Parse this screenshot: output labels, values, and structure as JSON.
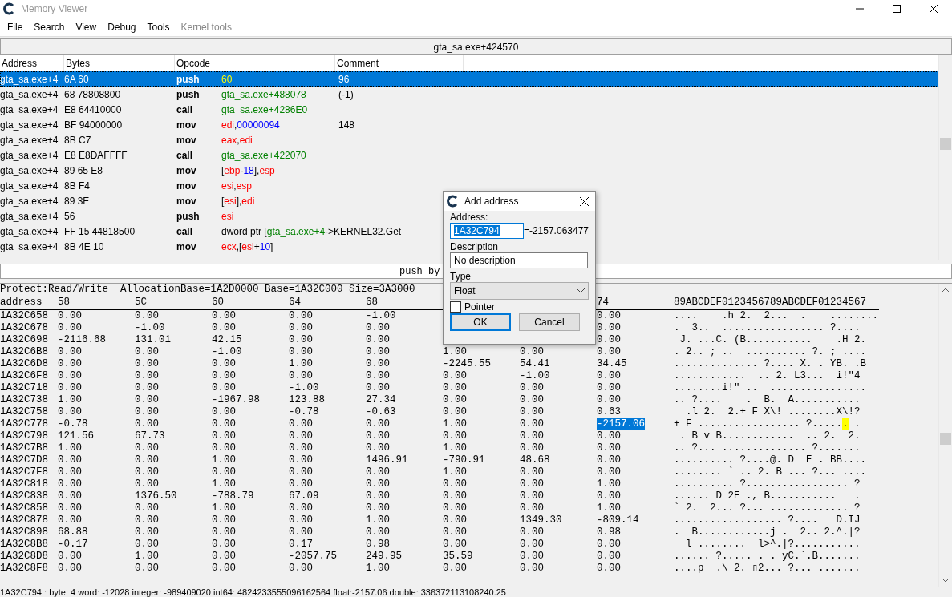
{
  "window": {
    "title": "Memory Viewer"
  },
  "menu": [
    {
      "label": "File",
      "disabled": false
    },
    {
      "label": "Search",
      "disabled": false
    },
    {
      "label": "View",
      "disabled": false
    },
    {
      "label": "Debug",
      "disabled": false
    },
    {
      "label": "Tools",
      "disabled": false
    },
    {
      "label": "Kernel tools",
      "disabled": true
    }
  ],
  "address_bar": "gta_sa.exe+424570",
  "disassembler": {
    "columns": [
      "Address",
      "Bytes",
      "Opcode",
      "Comment"
    ],
    "rows": [
      {
        "address": "gta_sa.exe+4",
        "bytes": "6A 60",
        "mnemonic": "push",
        "operand": [
          {
            "text": "60",
            "kind": "num"
          }
        ],
        "comment": "96",
        "selected": true
      },
      {
        "address": "gta_sa.exe+4",
        "bytes": "68 78808800",
        "mnemonic": "push",
        "operand": [
          {
            "text": "gta_sa.exe+488078",
            "kind": "sym"
          }
        ],
        "comment": "(-1)",
        "selected": false
      },
      {
        "address": "gta_sa.exe+4",
        "bytes": "E8 64410000",
        "mnemonic": "call",
        "operand": [
          {
            "text": "gta_sa.exe+4286E0",
            "kind": "sym"
          }
        ],
        "comment": "",
        "selected": false
      },
      {
        "address": "gta_sa.exe+4",
        "bytes": "BF 94000000",
        "mnemonic": "mov",
        "operand": [
          {
            "text": "edi",
            "kind": "reg"
          },
          {
            "text": ",",
            "kind": "plain"
          },
          {
            "text": "00000094",
            "kind": "num"
          }
        ],
        "comment": "148",
        "selected": false
      },
      {
        "address": "gta_sa.exe+4",
        "bytes": "8B C7",
        "mnemonic": "mov",
        "operand": [
          {
            "text": "eax",
            "kind": "reg"
          },
          {
            "text": ",",
            "kind": "plain"
          },
          {
            "text": "edi",
            "kind": "reg"
          }
        ],
        "comment": "",
        "selected": false
      },
      {
        "address": "gta_sa.exe+4",
        "bytes": "E8 E8DAFFFF",
        "mnemonic": "call",
        "operand": [
          {
            "text": "gta_sa.exe+422070",
            "kind": "sym"
          }
        ],
        "comment": "",
        "selected": false
      },
      {
        "address": "gta_sa.exe+4",
        "bytes": "89 65 E8",
        "mnemonic": "mov",
        "operand": [
          {
            "text": "[",
            "kind": "plain"
          },
          {
            "text": "ebp",
            "kind": "reg"
          },
          {
            "text": "-",
            "kind": "plain"
          },
          {
            "text": "18",
            "kind": "num"
          },
          {
            "text": "],",
            "kind": "plain"
          },
          {
            "text": "esp",
            "kind": "reg"
          }
        ],
        "comment": "",
        "selected": false
      },
      {
        "address": "gta_sa.exe+4",
        "bytes": "8B F4",
        "mnemonic": "mov",
        "operand": [
          {
            "text": "esi",
            "kind": "reg"
          },
          {
            "text": ",",
            "kind": "plain"
          },
          {
            "text": "esp",
            "kind": "reg"
          }
        ],
        "comment": "",
        "selected": false
      },
      {
        "address": "gta_sa.exe+4",
        "bytes": "89 3E",
        "mnemonic": "mov",
        "operand": [
          {
            "text": "[",
            "kind": "plain"
          },
          {
            "text": "esi",
            "kind": "reg"
          },
          {
            "text": "],",
            "kind": "plain"
          },
          {
            "text": "edi",
            "kind": "reg"
          }
        ],
        "comment": "",
        "selected": false
      },
      {
        "address": "gta_sa.exe+4",
        "bytes": "56",
        "mnemonic": "push",
        "operand": [
          {
            "text": "esi",
            "kind": "reg"
          }
        ],
        "comment": "",
        "selected": false
      },
      {
        "address": "gta_sa.exe+4",
        "bytes": "FF 15 44818500",
        "mnemonic": "call",
        "operand": [
          {
            "text": "dword ptr [",
            "kind": "plain"
          },
          {
            "text": "gta_sa.exe+4",
            "kind": "sym"
          },
          {
            "text": "->KERNEL32.Get",
            "kind": "plain"
          }
        ],
        "comment": "",
        "selected": false
      },
      {
        "address": "gta_sa.exe+4",
        "bytes": "8B 4E 10",
        "mnemonic": "mov",
        "operand": [
          {
            "text": "ecx",
            "kind": "reg"
          },
          {
            "text": ",[",
            "kind": "plain"
          },
          {
            "text": "esi",
            "kind": "reg"
          },
          {
            "text": "+",
            "kind": "plain"
          },
          {
            "text": "10",
            "kind": "num"
          },
          {
            "text": "]",
            "kind": "plain"
          }
        ],
        "comment": "",
        "selected": false
      }
    ]
  },
  "instruction_bar": "push by",
  "hex": {
    "info": "Protect:Read/Write  AllocationBase=1A2D0000 Base=1A32C000 Size=3A3000",
    "columns": [
      "address",
      "58",
      "5C",
      "60",
      "64",
      "68",
      null,
      null,
      "74"
    ],
    "ascii_header": "89ABCDEF0123456789ABCDEF01234567",
    "rows": [
      {
        "cells": [
          "1A32C658",
          "0.00",
          "0.00",
          "0.00",
          "0.00",
          "-1.00",
          null,
          null,
          "0.00"
        ],
        "ascii": "....    .h 2.  2...  .    ........"
      },
      {
        "cells": [
          "1A32C678",
          "0.00",
          "-1.00",
          "0.00",
          "0.00",
          "0.00",
          null,
          null,
          "0.00"
        ],
        "ascii": ".  3..  ................. ?...."
      },
      {
        "cells": [
          "1A32C698",
          "-2116.68",
          "131.01",
          "42.15",
          "0.00",
          "0.00",
          null,
          null,
          "0.00"
        ],
        "ascii": " J. ...C. (B...........    .H 2."
      },
      {
        "cells": [
          "1A32C6B8",
          "0.00",
          "0.00",
          "-1.00",
          "0.00",
          "0.00",
          "1.00",
          "0.00",
          "0.00"
        ],
        "ascii": ". 2.. ; ..  .......... ?. ; ...."
      },
      {
        "cells": [
          "1A32C6D8",
          "0.00",
          "0.00",
          "0.00",
          "1.00",
          "0.00",
          "-2245.55",
          "54.41",
          "34.45"
        ],
        "ascii": ".............. ?.... X. . YB. .B"
      },
      {
        "cells": [
          "1A32C6F8",
          "0.00",
          "0.00",
          "0.00",
          "0.00",
          "0.00",
          "0.00",
          "-1.00",
          "0.00"
        ],
        "ascii": "............  .. 2. L3...  i!\"4"
      },
      {
        "cells": [
          "1A32C718",
          "0.00",
          "0.00",
          "0.00",
          "-1.00",
          "0.00",
          "0.00",
          "0.00",
          "0.00"
        ],
        "ascii": "........i!\" ..  ................"
      },
      {
        "cells": [
          "1A32C738",
          "1.00",
          "0.00",
          "-1967.98",
          "123.88",
          "27.34",
          "0.00",
          "0.00",
          "0.00"
        ],
        "ascii": ".. ?....    .  B.  A..........."
      },
      {
        "cells": [
          "1A32C758",
          "0.00",
          "0.00",
          "0.00",
          "-0.78",
          "-0.63",
          "0.00",
          "0.00",
          "0.63"
        ],
        "ascii": "  .l 2.  2.+ F X\\! ........X\\!?"
      },
      {
        "cells": [
          "1A32C778",
          "-0.78",
          "0.00",
          "0.00",
          "0.00",
          "0.00",
          "1.00",
          "0.00",
          {
            "text": "-2157.06",
            "selected": true
          }
        ],
        "ascii": [
          {
            "text": "+ F ................. ?.....",
            "selected": false
          },
          {
            "text": ".",
            "selected": true
          },
          {
            "text": " .",
            "selected": false
          }
        ]
      },
      {
        "cells": [
          "1A32C798",
          "121.56",
          "67.73",
          "0.00",
          "0.00",
          "0.00",
          "0.00",
          "0.00",
          "0.00"
        ],
        "ascii": " . B v B............  .. 2.  2."
      },
      {
        "cells": [
          "1A32C7B8",
          "1.00",
          "0.00",
          "0.00",
          "0.00",
          "0.00",
          "1.00",
          "0.00",
          "0.00"
        ],
        "ascii": ".. ?... .............. ?......."
      },
      {
        "cells": [
          "1A32C7D8",
          "0.00",
          "0.00",
          "1.00",
          "0.00",
          "1496.91",
          "-790.91",
          "48.68",
          "0.00"
        ],
        "ascii": ".......... ?....@. D  E . BB...."
      },
      {
        "cells": [
          "1A32C7F8",
          "0.00",
          "0.00",
          "0.00",
          "0.00",
          "0.00",
          "1.00",
          "0.00",
          "0.00"
        ],
        "ascii": "........ ` .. 2. B ... ?... ...."
      },
      {
        "cells": [
          "1A32C818",
          "0.00",
          "0.00",
          "1.00",
          "0.00",
          "0.00",
          "0.00",
          "0.00",
          "1.00"
        ],
        "ascii": ".......... ?................. ?"
      },
      {
        "cells": [
          "1A32C838",
          "0.00",
          "1376.50",
          "-788.79",
          "67.09",
          "0.00",
          "0.00",
          "0.00",
          "0.00"
        ],
        "ascii": "...... D 2E ., B...........   ."
      },
      {
        "cells": [
          "1A32C858",
          "0.00",
          "0.00",
          "1.00",
          "0.00",
          "0.00",
          "0.00",
          "0.00",
          "1.00"
        ],
        "ascii": "` 2.  2... ?... ............. ?"
      },
      {
        "cells": [
          "1A32C878",
          "0.00",
          "0.00",
          "0.00",
          "0.00",
          "1.00",
          "0.00",
          "1349.30",
          "-809.14"
        ],
        "ascii": ".................. ?....   D.IJ"
      },
      {
        "cells": [
          "1A32C898",
          "68.88",
          "0.00",
          "0.00",
          "0.00",
          "0.00",
          "0.00",
          "0.00",
          "0.98"
        ],
        "ascii": ".  B............j .  2.. 2.^.|?"
      },
      {
        "cells": [
          "1A32C8B8",
          "-0.17",
          "0.00",
          "0.00",
          "0.17",
          "0.98",
          "0.00",
          "0.00",
          "0.00"
        ],
        "ascii": "  l ........  l>^.|?..........."
      },
      {
        "cells": [
          "1A32C8D8",
          "0.00",
          "1.00",
          "0.00",
          "-2057.75",
          "249.95",
          "35.59",
          "0.00",
          "0.00"
        ],
        "ascii": "...... ?..... . . yC.`.B......."
      },
      {
        "cells": [
          "1A32C8F8",
          "0.00",
          "0.00",
          "0.00",
          "0.00",
          "1.00",
          "0.00",
          "0.00",
          "0.00"
        ],
        "ascii": "....p  .\\ 2. ▯2... ?... ......."
      }
    ]
  },
  "status_bar": "1A32C794 : byte: 4 word: -12028 integer: -989409020 int64: 4824233555096162564 float:-2157.06 double: 336372113108240.25",
  "dialog": {
    "title": "Add address",
    "address_label": "Address:",
    "address_value": "1A32C794",
    "address_result": "=-2157.063477",
    "description_label": "Description",
    "description_value": "No description",
    "type_label": "Type",
    "type_value": "Float",
    "pointer": {
      "label": "Pointer",
      "checked": false
    },
    "buttons": [
      {
        "label": "OK",
        "focused": true
      },
      {
        "label": "Cancel",
        "focused": false
      }
    ]
  }
}
